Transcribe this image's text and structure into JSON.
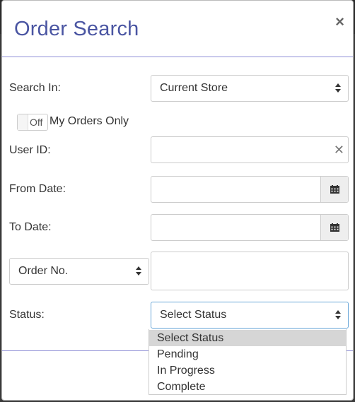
{
  "dialog": {
    "title": "Order Search",
    "close_symbol": "×"
  },
  "form": {
    "search_in": {
      "label": "Search In:",
      "value": "Current Store"
    },
    "my_orders": {
      "toggle_state": "Off",
      "label": "My Orders Only"
    },
    "user_id": {
      "label": "User ID:",
      "value": "",
      "clear_symbol": "✕"
    },
    "from_date": {
      "label": "From Date:",
      "value": ""
    },
    "to_date": {
      "label": "To Date:",
      "value": ""
    },
    "order_field": {
      "value": "Order No.",
      "input_value": ""
    },
    "status": {
      "label": "Status:",
      "value": "Select Status",
      "options": [
        "Select Status",
        "Pending",
        "In Progress",
        "Complete"
      ]
    }
  },
  "colors": {
    "title": "#4a55a2",
    "divider": "#8f8fd6",
    "highlight": "#d6d6d6"
  }
}
